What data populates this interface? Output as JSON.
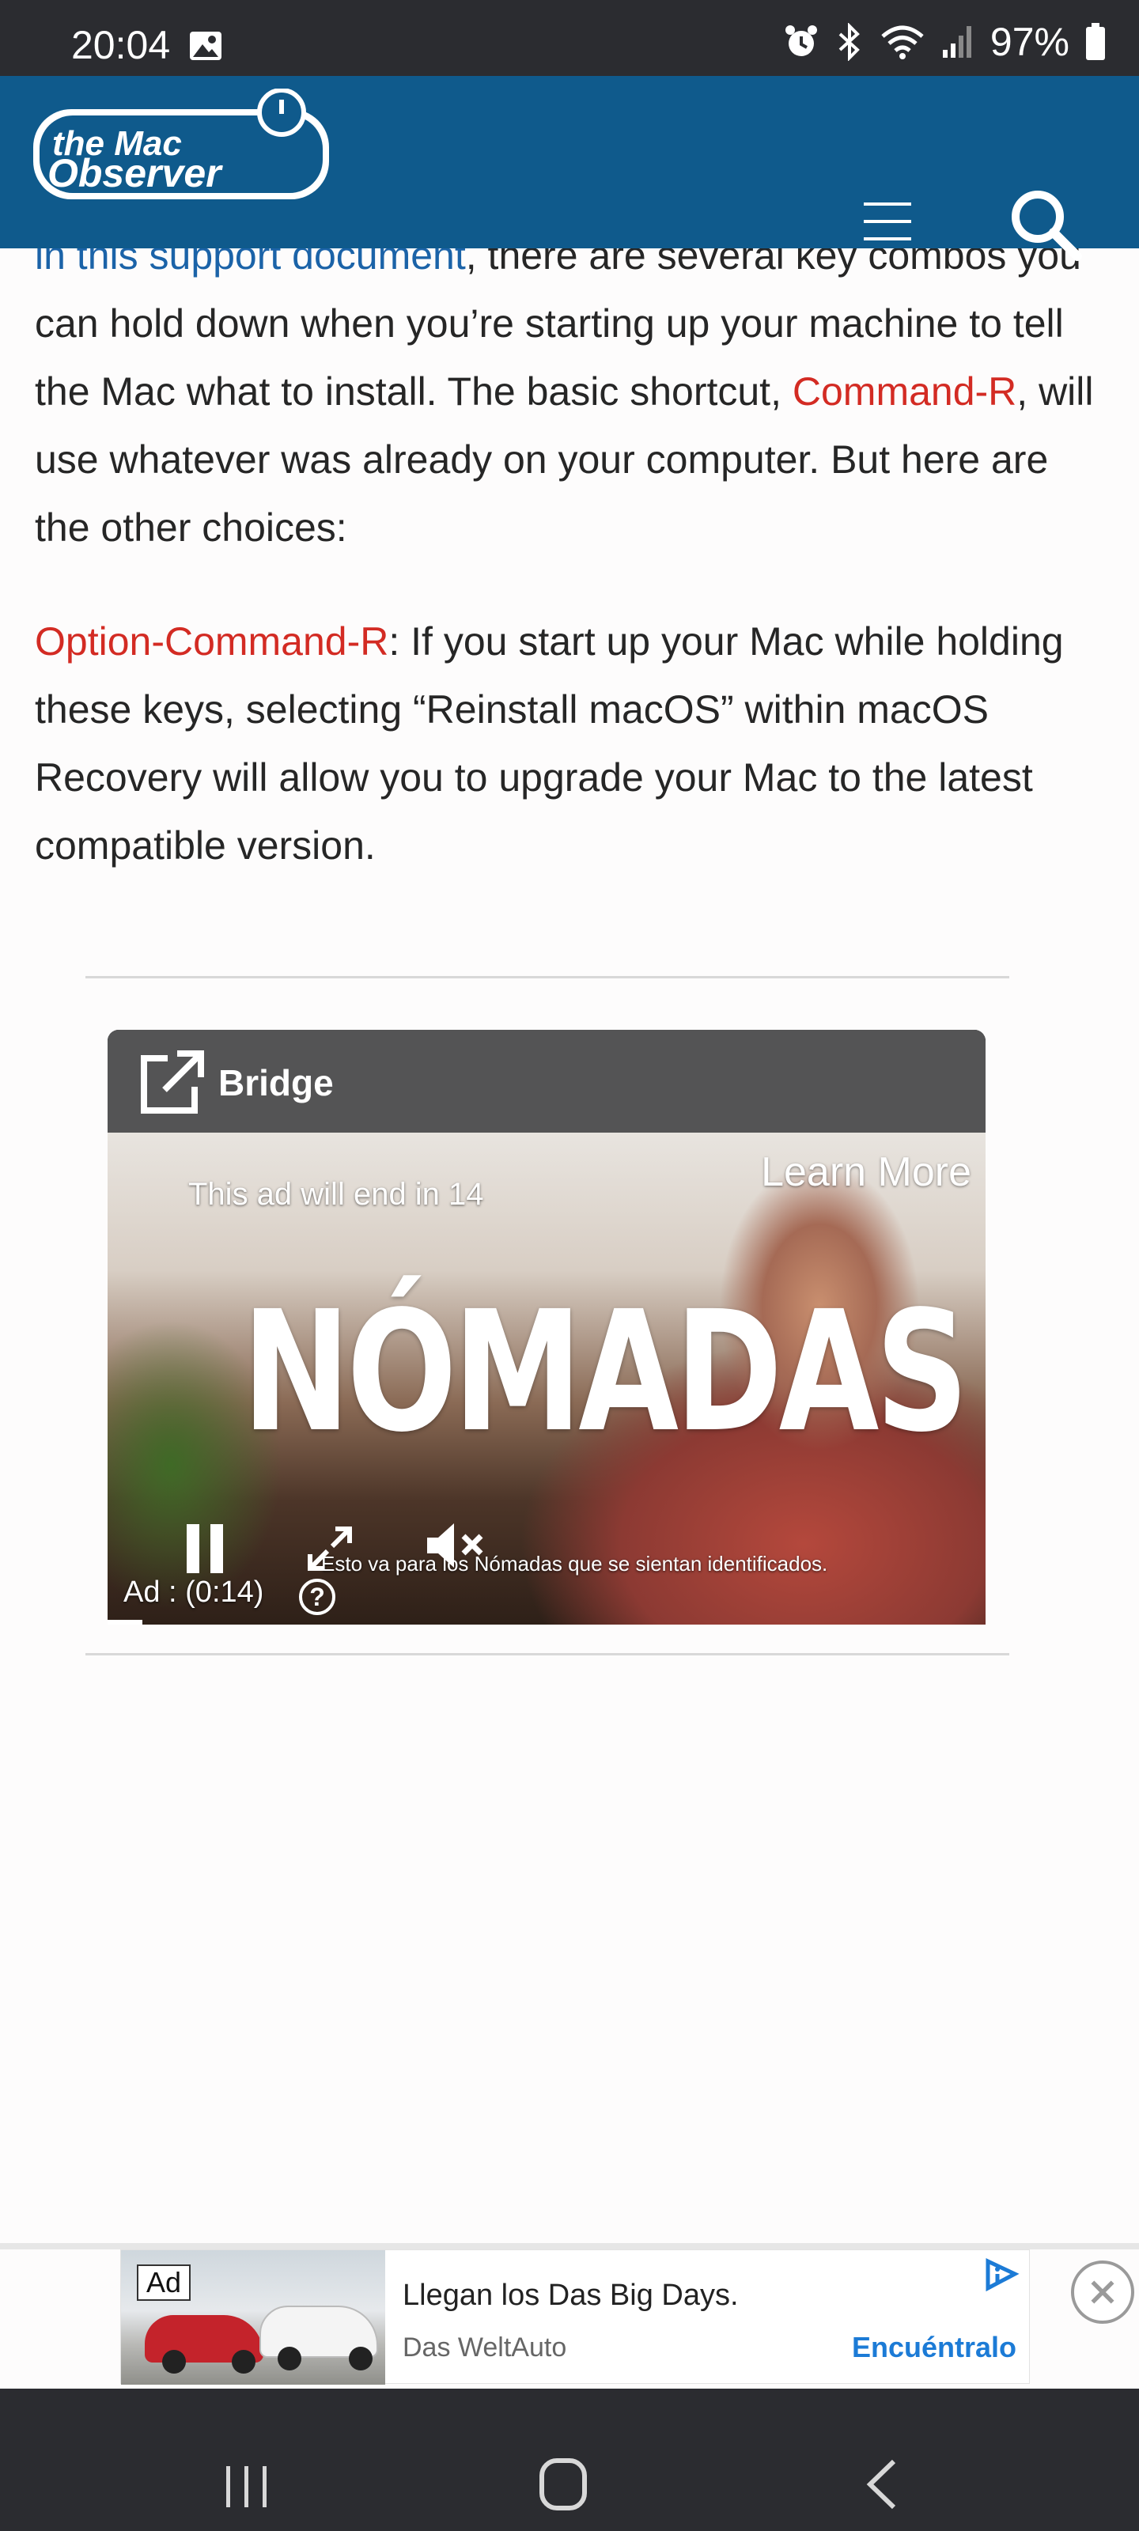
{
  "status_bar": {
    "time": "20:04",
    "battery": "97%",
    "icons": [
      "gallery-icon",
      "alarm-icon",
      "bluetooth-icon",
      "wifi-icon",
      "signal-icon",
      "battery-icon"
    ]
  },
  "header": {
    "logo_text_line1": "the Mac",
    "logo_text_line2": "Observer",
    "menu_icon": "hamburger-menu-icon",
    "search_icon": "search-icon",
    "bg_color": "#0f5a8c"
  },
  "article": {
    "p1_link": "in this support document",
    "p1_text_a": ", there are several key combos you can hold down when you’re starting up your machine to tell the Mac what to install. The basic shortcut, ",
    "p1_key": "Command-R",
    "p1_text_b": ", will use whatever was already on your computer. But here are the other choices:",
    "p2_key": "Option-Command-R",
    "p2_text": ": If you start up your Mac while holding these keys, selecting “Reinstall macOS” within macOS Recovery will allow you to upgrade your Mac to the latest compatible version.",
    "link_color": "#1b63a8",
    "key_color": "#d32b23"
  },
  "video_ad": {
    "brand": "Bridge",
    "learn_more": "Learn More",
    "countdown": "This ad will end in 14",
    "title": "NÓMADAS",
    "subtitle": "Esto va para los Nómadas que se sientan identificados.",
    "ad_time": "Ad : (0:14)",
    "help": "?",
    "progress": 0.04
  },
  "banner_ad": {
    "tag": "Ad",
    "headline": "Llegan los Das Big Days.",
    "advertiser": "Das WeltAuto",
    "cta": "Encuéntralo"
  },
  "nav_bar": {
    "icons": [
      "recents-icon",
      "home-icon",
      "back-icon"
    ]
  }
}
